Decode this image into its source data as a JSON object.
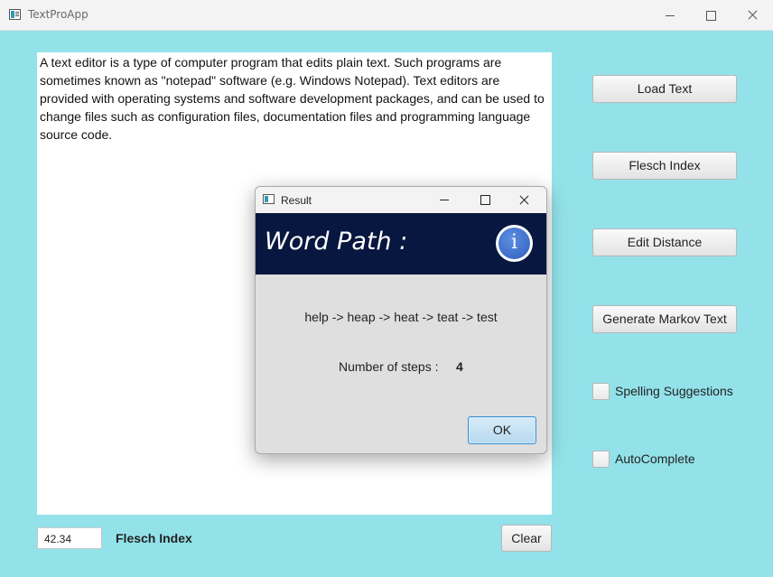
{
  "window": {
    "title": "TextProApp"
  },
  "editor": {
    "text": "A text editor is a type of computer program that edits plain text. Such programs are sometimes known as \"notepad\" software (e.g. Windows Notepad). Text editors are provided with operating systems and software development packages, and can be used to change files such as configuration files, documentation files and programming language source code."
  },
  "sidebar": {
    "buttons": [
      {
        "label": "Load Text"
      },
      {
        "label": "Flesch Index"
      },
      {
        "label": "Edit Distance"
      },
      {
        "label": "Generate Markov Text"
      }
    ],
    "checkboxes": [
      {
        "label": "Spelling Suggestions",
        "checked": false
      },
      {
        "label": "AutoComplete",
        "checked": false
      }
    ]
  },
  "footer": {
    "flesch_value": "42.34",
    "flesch_label": "Flesch Index",
    "clear_label": "Clear"
  },
  "dialog": {
    "title": "Result",
    "heading": "Word Path :",
    "info_glyph": "i",
    "path": "help -> heap -> heat -> teat -> test",
    "steps_label": "Number of steps :",
    "steps_value": "4",
    "ok_label": "OK"
  },
  "colors": {
    "content_background": "#93e2ea",
    "dialog_header": "#07173f",
    "info_icon": "#3a6dd0"
  }
}
